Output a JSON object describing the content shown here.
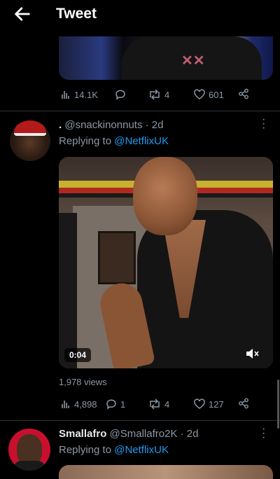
{
  "header": {
    "title": "Tweet"
  },
  "tweet_prev": {
    "stats": {
      "views": "14.1K",
      "replies": "",
      "retweets": "4",
      "likes": "601"
    }
  },
  "tweet1": {
    "prefix": ".",
    "handle": "@snackinonnuts",
    "time": "· 2d",
    "replying_label": "Replying to",
    "replying_to": "@NetflixUK",
    "video_time": "0:04",
    "views_label": "1,978 views",
    "stats": {
      "views": "4,898",
      "replies": "1",
      "retweets": "4",
      "likes": "127"
    }
  },
  "tweet2": {
    "name": "Smallafro",
    "handle": "@Smallafro2K",
    "time": "· 2d",
    "replying_label": "Replying to",
    "replying_to": "@NetflixUK"
  },
  "colors": {
    "link": "#1d9bf0",
    "muted": "#8b98a5",
    "background": "#000000"
  }
}
